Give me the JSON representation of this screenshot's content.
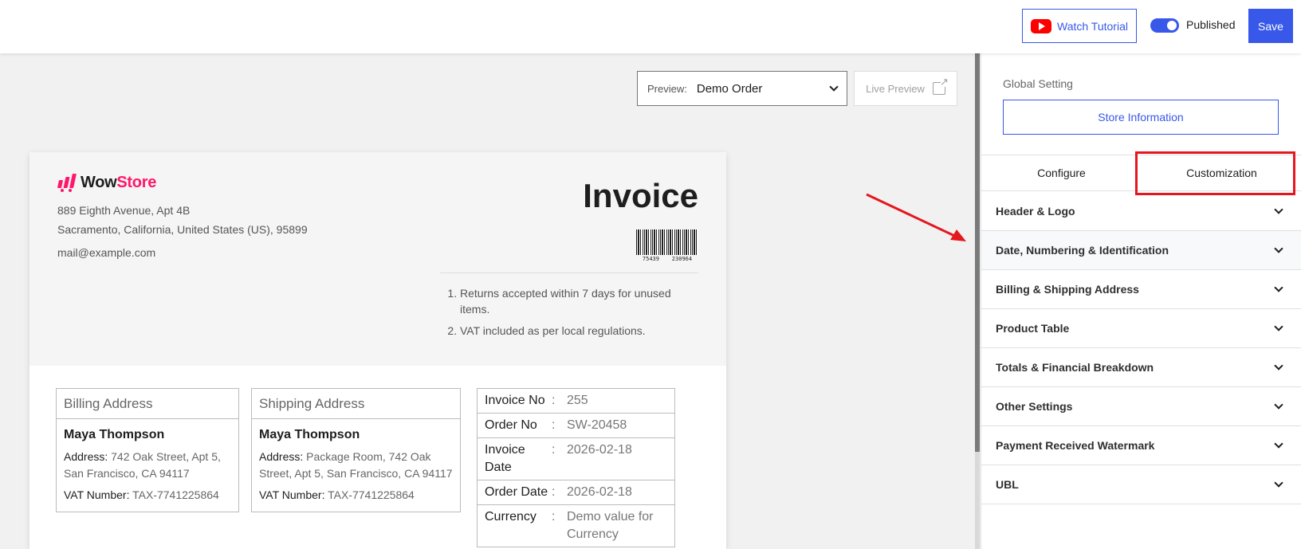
{
  "topbar": {
    "tutorial_label": "Watch Tutorial",
    "published_label": "Published",
    "published_on": true,
    "save_label": "Save"
  },
  "preview": {
    "label": "Preview:",
    "selected": "Demo Order",
    "live_label": "Live Preview"
  },
  "invoice": {
    "logo_text_a": "Wow",
    "logo_text_b": "Store",
    "address_line1": "889 Eighth Avenue, Apt 4B",
    "address_line2": "Sacramento, California, United States (US), 95899",
    "email": "mail@example.com",
    "title": "Invoice",
    "barcode_left": "75439",
    "barcode_right": "230964",
    "notes": [
      "Returns accepted within 7 days for unused items.",
      "VAT included as per local regulations."
    ],
    "billing": {
      "heading": "Billing Address",
      "name": "Maya Thompson",
      "address_label": "Address:",
      "address": "742 Oak Street, Apt 5, San Francisco, CA 94117",
      "vat_label": "VAT Number:",
      "vat": "TAX-7741225864"
    },
    "shipping": {
      "heading": "Shipping Address",
      "name": "Maya Thompson",
      "address_label": "Address:",
      "address": "Package Room, 742 Oak Street, Apt 5, San Francisco, CA 94117",
      "vat_label": "VAT Number:",
      "vat": "TAX-7741225864"
    },
    "meta": [
      {
        "key": "Invoice No",
        "sep": ":",
        "value": "255"
      },
      {
        "key": "Order No",
        "sep": ":",
        "value": "SW-20458"
      },
      {
        "key": "Invoice Date",
        "sep": ":",
        "value": "2026-02-18"
      },
      {
        "key": "Order Date",
        "sep": ":",
        "value": "2026-02-18"
      },
      {
        "key": "Currency",
        "sep": ":",
        "value": "Demo value for Currency"
      }
    ]
  },
  "panel": {
    "global_label": "Global Setting",
    "store_button": "Store Information",
    "tabs": [
      "Configure",
      "Customization"
    ],
    "sections": [
      "Header & Logo",
      "Date, Numbering & Identification",
      "Billing & Shipping Address",
      "Product Table",
      "Totals & Financial Breakdown",
      "Other Settings",
      "Payment Received Watermark",
      "UBL"
    ]
  },
  "colors": {
    "accent": "#3858e9",
    "brand": "#ff176b",
    "highlight": "#e5161e"
  }
}
